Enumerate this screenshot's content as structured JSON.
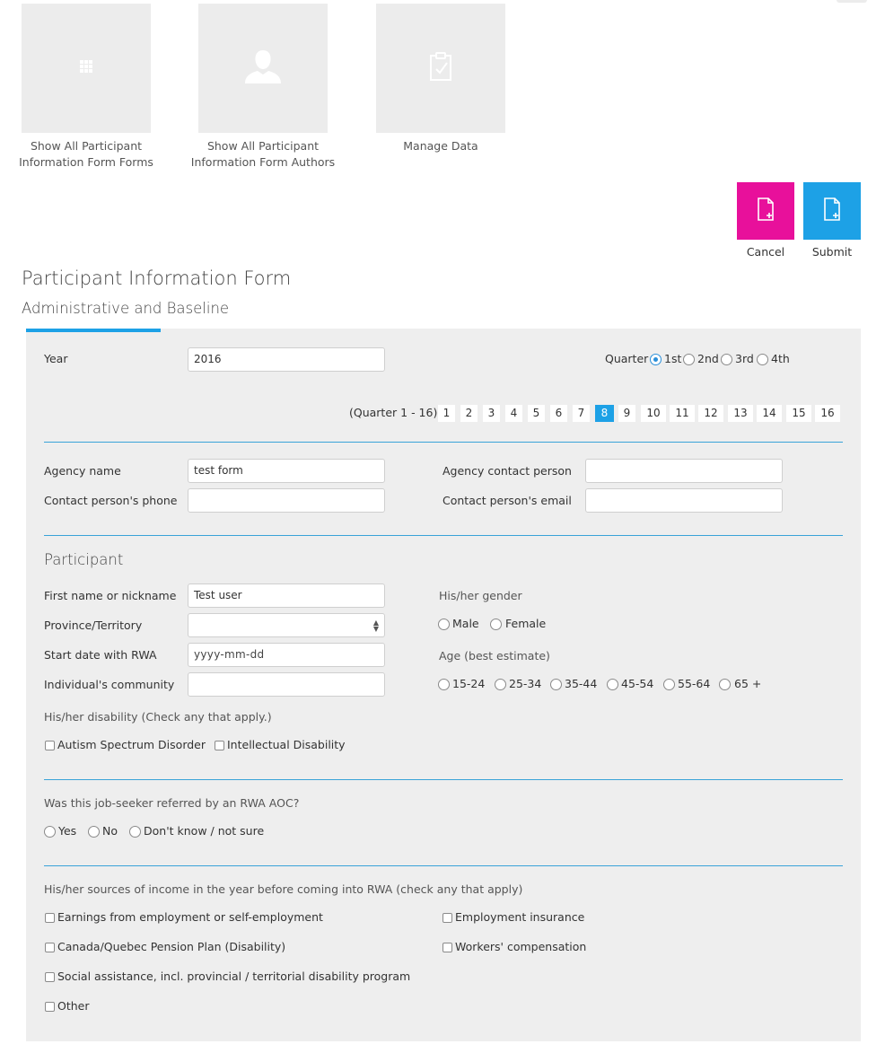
{
  "tiles": [
    {
      "label": "Show All Participant Information Form Forms",
      "icon": "grid-icon"
    },
    {
      "label": "Show All Participant Information Form Authors",
      "icon": "user-icon"
    },
    {
      "label": "Manage Data",
      "icon": "clipboard-check-icon"
    }
  ],
  "actions": {
    "cancel_label": "Cancel",
    "submit_label": "Submit",
    "cancel_color": "#e8109b",
    "submit_color": "#1da1e6"
  },
  "form": {
    "title": "Participant Information Form",
    "subtitle": "Administrative and Baseline",
    "accent_color": "#1da1e6",
    "year": {
      "label": "Year",
      "value": "2016"
    },
    "quarter": {
      "label": "Quarter",
      "options": [
        "1st",
        "2nd",
        "3rd",
        "4th"
      ],
      "selected": "1st"
    },
    "quarter_pages": {
      "label": "(Quarter 1 - 16)",
      "pages": [
        "1",
        "2",
        "3",
        "4",
        "5",
        "6",
        "7",
        "8",
        "9",
        "10",
        "11",
        "12",
        "13",
        "14",
        "15",
        "16"
      ],
      "active": "8"
    },
    "agency": {
      "name_label": "Agency name",
      "name_value": "test form",
      "contact_label": "Agency contact person",
      "contact_value": "",
      "phone_label": "Contact person's phone",
      "phone_value": "",
      "email_label": "Contact person's email",
      "email_value": ""
    },
    "participant": {
      "heading": "Participant",
      "first_name_label": "First name or nickname",
      "first_name_value": "Test user",
      "province_label": "Province/Territory",
      "province_value": "",
      "start_date_label": "Start date with RWA",
      "start_date_placeholder": "yyyy-mm-dd",
      "community_label": "Individual's community",
      "community_value": "",
      "gender_label": "His/her gender",
      "gender_options": [
        "Male",
        "Female"
      ],
      "age_label": "Age (best estimate)",
      "age_options": [
        "15-24",
        "25-34",
        "35-44",
        "45-54",
        "55-64",
        "65 +"
      ],
      "disability_label": "His/her disability (Check any that apply.)",
      "disability_options": [
        "Autism Spectrum Disorder",
        "Intellectual Disability"
      ]
    },
    "referral": {
      "question": "Was this job-seeker referred by an RWA AOC?",
      "options": [
        "Yes",
        "No",
        "Don't know / not sure"
      ]
    },
    "income": {
      "question": "His/her sources of income in the year before coming into RWA (check any that apply)",
      "options": [
        "Earnings from employment or self-employment",
        "Employment insurance",
        "Canada/Quebec Pension Plan (Disability)",
        "Workers' compensation",
        "Social assistance, incl. provincial / territorial disability program",
        "Other"
      ]
    }
  }
}
